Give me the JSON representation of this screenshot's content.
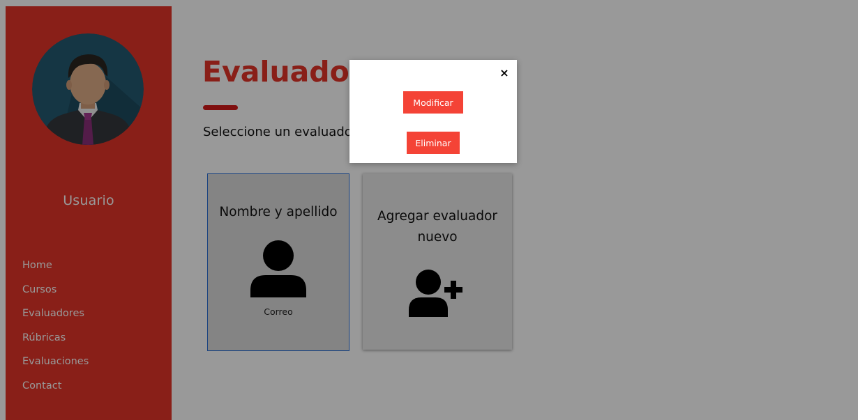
{
  "sidebar": {
    "user_name": "Usuario",
    "avatar_icon": "person-avatar-icon",
    "background_color": "#e53528",
    "nav_items": [
      {
        "label": "Home"
      },
      {
        "label": "Cursos"
      },
      {
        "label": "Evaluadores"
      },
      {
        "label": "Rúbricas"
      },
      {
        "label": "Evaluaciones"
      },
      {
        "label": "Contact"
      }
    ]
  },
  "main": {
    "title": "Evaluadores",
    "subtitle": "Seleccione un evaluador",
    "accent_color": "#d41a1a"
  },
  "cards": {
    "evaluator": {
      "name": "Nombre y apellido",
      "email": "Correo",
      "icon": "user-icon"
    },
    "add": {
      "label": "Agregar evaluador nuevo",
      "icon": "add-user-icon"
    }
  },
  "modal": {
    "close_label": "×",
    "modify_label": "Modificar",
    "delete_label": "Eliminar",
    "button_color": "#f44336"
  }
}
